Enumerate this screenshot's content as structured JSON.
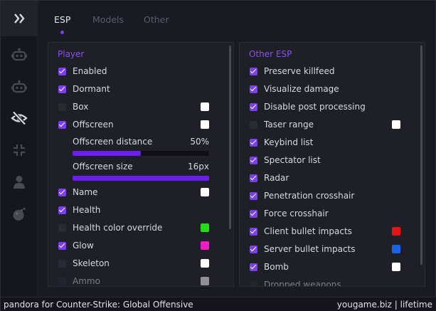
{
  "tabs": [
    {
      "label": "ESP",
      "active": true
    },
    {
      "label": "Models",
      "active": false
    },
    {
      "label": "Other",
      "active": false
    }
  ],
  "sidebar": {
    "items": [
      {
        "icon": "double-chevron-right-icon"
      },
      {
        "icon": "robot-icon"
      },
      {
        "icon": "robot-icon"
      },
      {
        "icon": "eye-off-icon",
        "active": true
      },
      {
        "icon": "crosshair-icon"
      },
      {
        "icon": "user-icon"
      },
      {
        "icon": "bomb-icon"
      }
    ]
  },
  "left_panel": {
    "title": "Player",
    "items": [
      {
        "label": "Enabled",
        "checked": true
      },
      {
        "label": "Dormant",
        "checked": true
      },
      {
        "label": "Box",
        "checked": false,
        "color": "#ffffff"
      },
      {
        "label": "Offscreen",
        "checked": true,
        "color": "#ffffff"
      },
      {
        "label": "Name",
        "checked": true,
        "color": "#ffffff"
      },
      {
        "label": "Health",
        "checked": true
      },
      {
        "label": "Health color override",
        "checked": false,
        "color": "#22e012"
      },
      {
        "label": "Glow",
        "checked": true,
        "color": "#f01cc8"
      },
      {
        "label": "Skeleton",
        "checked": false,
        "color": "#ffffff"
      },
      {
        "label": "Ammo",
        "checked": false,
        "color": "#ffffff"
      }
    ],
    "sliders": [
      {
        "label": "Offscreen distance",
        "value": "50%",
        "fraction": 0.5
      },
      {
        "label": "Offscreen size",
        "value": "16px",
        "fraction": 1.0
      }
    ]
  },
  "right_panel": {
    "title": "Other ESP",
    "items": [
      {
        "label": "Preserve killfeed",
        "checked": true
      },
      {
        "label": "Visualize damage",
        "checked": true
      },
      {
        "label": "Disable post processing",
        "checked": true
      },
      {
        "label": "Taser range",
        "checked": false,
        "color": "#ffffff"
      },
      {
        "label": "Keybind list",
        "checked": true
      },
      {
        "label": "Spectator list",
        "checked": true
      },
      {
        "label": "Radar",
        "checked": true
      },
      {
        "label": "Penetration crosshair",
        "checked": true
      },
      {
        "label": "Force crosshair",
        "checked": true
      },
      {
        "label": "Client bullet impacts",
        "checked": true,
        "color": "#e41414"
      },
      {
        "label": "Server bullet impacts",
        "checked": true,
        "color": "#1a62e8"
      },
      {
        "label": "Bomb",
        "checked": true,
        "color": "#ffffff"
      },
      {
        "label": "Dropped weapons",
        "checked": false
      }
    ]
  },
  "footer": {
    "left": "pandora for Counter-Strike: Global Offensive",
    "right": "yougame.biz | lifetime"
  },
  "colors": {
    "accent": "#7b3ef0",
    "slider_fill": "#6a1ef0"
  }
}
